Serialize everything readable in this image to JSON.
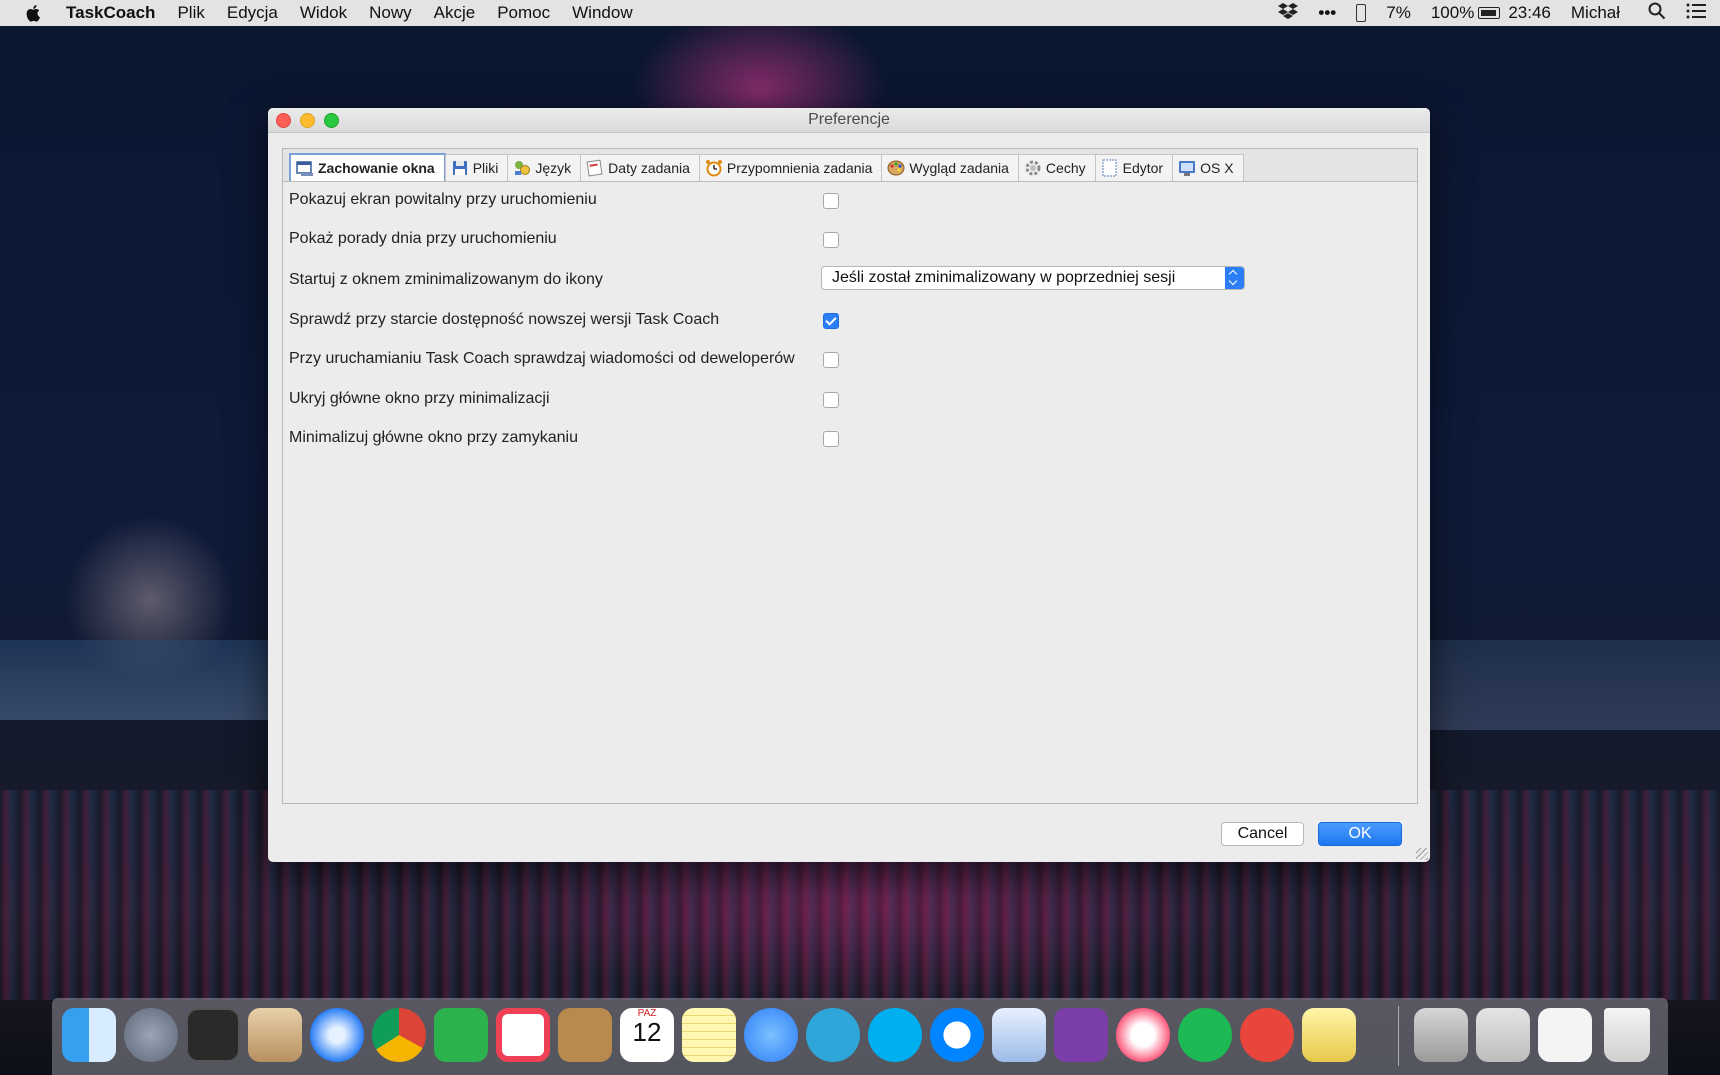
{
  "menubar": {
    "app_name": "TaskCoach",
    "menus": [
      "Plik",
      "Edycja",
      "Widok",
      "Nowy",
      "Akcje",
      "Pomoc",
      "Window"
    ],
    "battery_small": "7%",
    "battery_main": "100%",
    "clock": "23:46",
    "user": "Michał",
    "icons": [
      "apple-icon",
      "dropbox-icon",
      "more-icon",
      "phone-icon",
      "battery-icon",
      "search-icon",
      "list-icon"
    ]
  },
  "window": {
    "title": "Preferencje",
    "tabs": [
      {
        "label": "Zachowanie okna",
        "icon": "window-icon",
        "active": true
      },
      {
        "label": "Pliki",
        "icon": "save-icon"
      },
      {
        "label": "Język",
        "icon": "language-icon"
      },
      {
        "label": "Daty zadania",
        "icon": "calendar-icon"
      },
      {
        "label": "Przypomnienia zadania",
        "icon": "alarm-clock-icon"
      },
      {
        "label": "Wygląd zadania",
        "icon": "palette-icon"
      },
      {
        "label": "Cechy",
        "icon": "gear-icon"
      },
      {
        "label": "Edytor",
        "icon": "editor-icon"
      },
      {
        "label": "OS X",
        "icon": "osx-icon"
      }
    ],
    "settings": [
      {
        "label": "Pokazuj ekran powitalny przy uruchomieniu",
        "checked": false
      },
      {
        "label": "Pokaż porady dnia przy uruchomieniu",
        "checked": false
      },
      {
        "label": "Startuj z oknem zminimalizowanym do ikony",
        "select_value": "Jeśli został zminimalizowany w poprzedniej sesji"
      },
      {
        "label": "Sprawdź przy starcie dostępność nowszej wersji Task Coach",
        "checked": true
      },
      {
        "label": "Przy uruchamianiu Task Coach sprawdzaj wiadomości od deweloperów",
        "checked": false
      },
      {
        "label": "Ukryj główne okno przy minimalizacji",
        "checked": false
      },
      {
        "label": "Minimalizuj główne okno przy zamykaniu",
        "checked": false
      }
    ],
    "buttons": {
      "cancel": "Cancel",
      "ok": "OK"
    }
  },
  "dock": {
    "apps": [
      "finder-icon",
      "launchpad-icon",
      "mission-control-icon",
      "mail-icon",
      "safari-icon",
      "chrome-icon",
      "feedly-icon",
      "pocket-icon",
      "contacts-icon",
      "calendar-icon",
      "notes-icon",
      "messages-icon",
      "telegram-icon",
      "skype-icon",
      "messenger-icon",
      "preview-icon",
      "onenote-icon",
      "itunes-icon",
      "spotify-icon",
      "transmit-icon",
      "taskcoach-icon",
      "downloads-stack-icon",
      "photos-stack-icon",
      "documents-stack-icon",
      "trash-icon"
    ],
    "calendar_month": "PAŹ",
    "calendar_day": "12"
  }
}
